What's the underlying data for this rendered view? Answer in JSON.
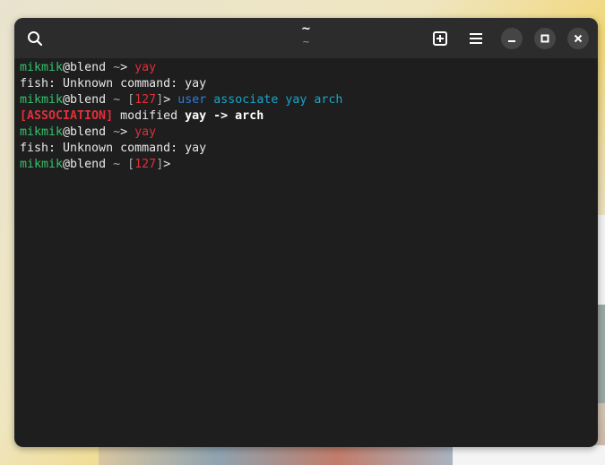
{
  "header": {
    "title": "~",
    "subtitle": "~"
  },
  "terminal": {
    "user": "mikmik",
    "host": "@blend",
    "tilde": "~",
    "prompt_end": ">",
    "status": "127",
    "lines": {
      "l1_cmd": "yay",
      "l2": "fish: Unknown command: yay",
      "l3_cmd1": "user",
      "l3_cmd2": "associate yay arch",
      "l4_tag": "[ASSOCIATION]",
      "l4_mid": " modified ",
      "l4_bold": "yay -> arch",
      "l5_cmd": "yay",
      "l6": "fish: Unknown command: yay"
    }
  },
  "colors": {
    "user": "#33c26b",
    "error": "#e02e3a",
    "command": "#2a7fe0",
    "arg": "#17a6c9"
  }
}
